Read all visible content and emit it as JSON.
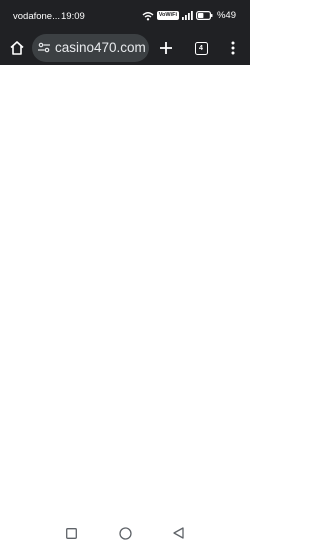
{
  "status_bar": {
    "carrier": "vodafone...",
    "time": "19:09",
    "vowifi_label": "VoWiFi",
    "battery_percent": "%49",
    "battery_level": 0.49,
    "icons": [
      "wifi-icon",
      "vowifi-icon",
      "signal-icon",
      "battery-icon"
    ]
  },
  "browser_toolbar": {
    "url": "casino470.com",
    "tab_count": "4",
    "icons": [
      "home-icon",
      "site-settings-icon",
      "new-tab-icon",
      "tab-switcher-icon",
      "more-menu-icon"
    ]
  },
  "system_nav": {
    "icons": [
      "recent-apps-icon",
      "home-circle-icon",
      "back-triangle-icon"
    ]
  },
  "colors": {
    "chrome_dark": "#202124",
    "omnibox": "#3c4043",
    "page_background": "#ffffff"
  }
}
